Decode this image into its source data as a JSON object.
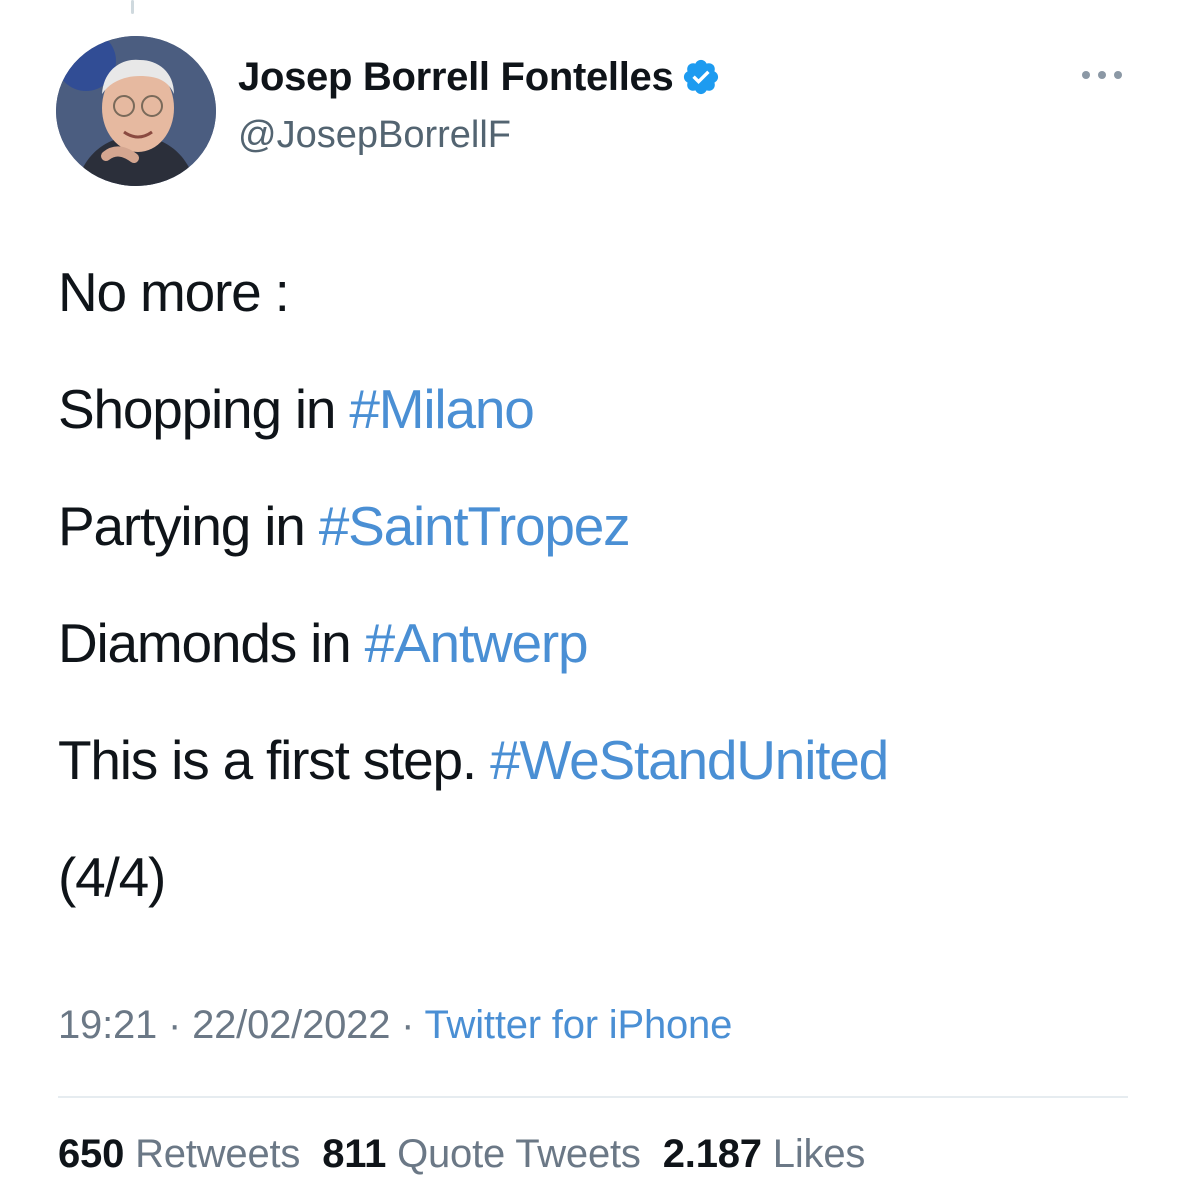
{
  "tweet": {
    "author": {
      "name": "Josep Borrell Fontelles",
      "handle": "@JosepBorrellF",
      "verified": true
    },
    "lines": [
      {
        "text": "No more :",
        "hashtag": ""
      },
      {
        "text": "Shopping in ",
        "hashtag": "#Milano"
      },
      {
        "text": "Partying in ",
        "hashtag": "#SaintTropez"
      },
      {
        "text": "Diamonds in ",
        "hashtag": "#Antwerp"
      },
      {
        "text": "This is a first step. ",
        "hashtag": "#WeStandUnited"
      },
      {
        "text": "(4/4)",
        "hashtag": ""
      }
    ],
    "time": "19:21",
    "date": "22/02/2022",
    "source": "Twitter for iPhone",
    "stats": {
      "retweets": {
        "count": "650",
        "label": "Retweets"
      },
      "quotes": {
        "count": "811",
        "label": "Quote Tweets"
      },
      "likes": {
        "count": "2.187",
        "label": "Likes"
      }
    }
  },
  "colors": {
    "link": "#4a8fd4",
    "verified": "#1d9bf0",
    "text": "#0f1419",
    "secondary": "#6b7886"
  }
}
